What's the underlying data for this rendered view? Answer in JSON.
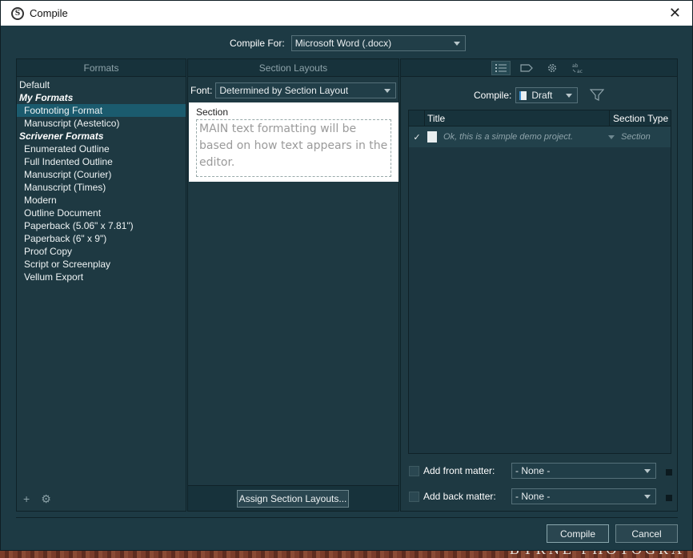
{
  "window": {
    "title": "Compile",
    "app_icon": "S"
  },
  "compile_for": {
    "label": "Compile For:",
    "value": "Microsoft Word (.docx)"
  },
  "formats": {
    "header": "Formats",
    "items": [
      {
        "label": "Default",
        "kind": "plain"
      },
      {
        "label": "My Formats",
        "kind": "group"
      },
      {
        "label": "Footnoting Format",
        "kind": "item",
        "selected": true
      },
      {
        "label": "Manuscript (Aestetico)",
        "kind": "item"
      },
      {
        "label": "Scrivener Formats",
        "kind": "group"
      },
      {
        "label": "Enumerated Outline",
        "kind": "item"
      },
      {
        "label": "Full Indented Outline",
        "kind": "item"
      },
      {
        "label": "Manuscript (Courier)",
        "kind": "item"
      },
      {
        "label": "Manuscript (Times)",
        "kind": "item"
      },
      {
        "label": "Modern",
        "kind": "item"
      },
      {
        "label": "Outline Document",
        "kind": "item"
      },
      {
        "label": "Paperback (5.06\" x 7.81\")",
        "kind": "item"
      },
      {
        "label": "Paperback (6\" x 9\")",
        "kind": "item"
      },
      {
        "label": "Proof Copy",
        "kind": "item"
      },
      {
        "label": "Script or Screenplay",
        "kind": "item"
      },
      {
        "label": "Vellum Export",
        "kind": "item"
      }
    ],
    "footer_add": "+",
    "footer_gear": "⚙"
  },
  "section_layouts": {
    "header": "Section Layouts",
    "font_label": "Font:",
    "font_value": "Determined by Section Layout",
    "card_title": "Section",
    "card_preview": "MAIN text formatting will be based on how text appears in the editor.",
    "assign_button": "Assign Section Layouts..."
  },
  "contents": {
    "compile_label": "Compile:",
    "compile_value": "Draft",
    "columns": {
      "title": "Title",
      "type": "Section Type"
    },
    "rows": [
      {
        "checked": "✓",
        "title": "Ok, this is a simple demo project.",
        "type": "Section"
      }
    ],
    "front_matter": {
      "label": "Add front matter:",
      "value": "- None -"
    },
    "back_matter": {
      "label": "Add back matter:",
      "value": "- None -"
    }
  },
  "buttons": {
    "compile": "Compile",
    "cancel": "Cancel"
  },
  "background": {
    "bottom_text": "BYRNE  PHOTOGRA"
  }
}
